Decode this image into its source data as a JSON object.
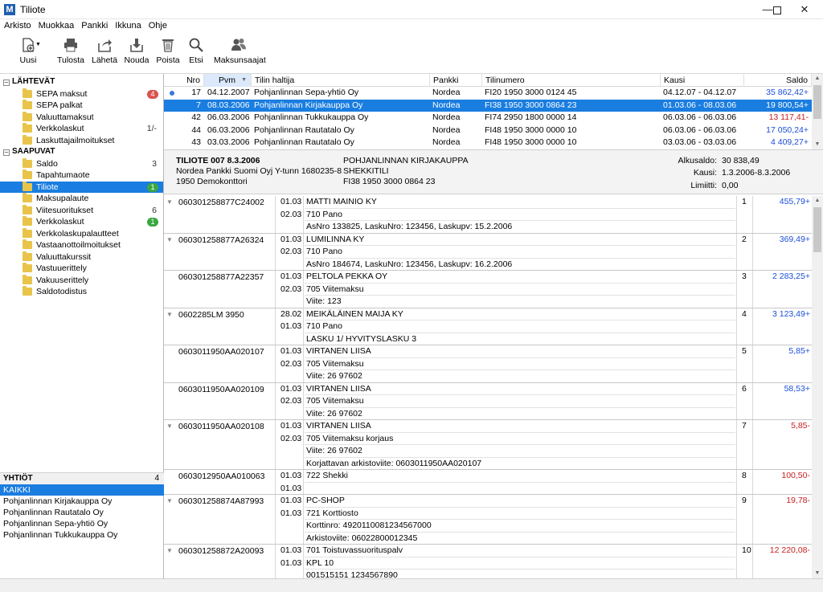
{
  "window": {
    "title": "Tiliote",
    "app_icon_letter": "M"
  },
  "menu": [
    "Arkisto",
    "Muokkaa",
    "Pankki",
    "Ikkuna",
    "Ohje"
  ],
  "toolbar": {
    "new": "Uusi",
    "print": "Tulosta",
    "send": "Lähetä",
    "fetch": "Nouda",
    "delete": "Poista",
    "search": "Etsi",
    "payees": "Maksunsaajat"
  },
  "sidebar": {
    "outgoing_header": "LÄHTEVÄT",
    "outgoing": [
      {
        "label": "SEPA maksut",
        "badge": "4",
        "badge_color": "#d9534f"
      },
      {
        "label": "SEPA palkat"
      },
      {
        "label": "Valuuttamaksut"
      },
      {
        "label": "Verkkolaskut",
        "count": "1/-"
      },
      {
        "label": "Laskuttajailmoitukset"
      }
    ],
    "incoming_header": "SAAPUVAT",
    "incoming": [
      {
        "label": "Saldo",
        "count": "3"
      },
      {
        "label": "Tapahtumaote"
      },
      {
        "label": "Tiliote",
        "badge": "1",
        "badge_color": "#3aa842",
        "selected": true
      },
      {
        "label": "Maksupalaute"
      },
      {
        "label": "Viitesuoritukset",
        "count": "6"
      },
      {
        "label": "Verkkolaskut",
        "badge": "1",
        "badge_color": "#3aa842"
      },
      {
        "label": "Verkkolaskupalautteet"
      },
      {
        "label": "Vastaanottoilmoitukset"
      },
      {
        "label": "Valuuttakurssit"
      },
      {
        "label": "Vastuuerittely"
      },
      {
        "label": "Vakuuserittely"
      },
      {
        "label": "Saldotodistus"
      }
    ]
  },
  "companies": {
    "header": "YHTIÖT",
    "count": "4",
    "items": [
      "KAIKKI",
      "Pohjanlinnan Kirjakauppa Oy",
      "Pohjanlinnan Rautatalo Oy",
      "Pohjanlinnan Sepa-yhtiö Oy",
      "Pohjanlinnan Tukkukauppa Oy"
    ]
  },
  "statements": {
    "columns": {
      "nro": "Nro",
      "pvm": "Pvm",
      "holder": "Tilin haltija",
      "bank": "Pankki",
      "account": "Tilinumero",
      "period": "Kausi",
      "balance": "Saldo"
    },
    "rows": [
      {
        "nro": "17",
        "pvm": "04.12.2007",
        "holder": "Pohjanlinnan Sepa-yhtiö Oy",
        "bank": "Nordea",
        "account": "FI20 1950 3000 0124 45",
        "period": "04.12.07 - 04.12.07",
        "balance": "35 862,42+",
        "sign": "pos",
        "dot": true
      },
      {
        "nro": "7",
        "pvm": "08.03.2006",
        "holder": "Pohjanlinnan Kirjakauppa Oy",
        "bank": "Nordea",
        "account": "FI38 1950 3000 0864 23",
        "period": "01.03.06 - 08.03.06",
        "balance": "19 800,54+",
        "sign": "pos",
        "selected": true
      },
      {
        "nro": "42",
        "pvm": "06.03.2006",
        "holder": "Pohjanlinnan Tukkukauppa Oy",
        "bank": "Nordea",
        "account": "FI74 2950 1800 0000 14",
        "period": "06.03.06 - 06.03.06",
        "balance": "13 117,41-",
        "sign": "neg"
      },
      {
        "nro": "44",
        "pvm": "06.03.2006",
        "holder": "Pohjanlinnan Rautatalo Oy",
        "bank": "Nordea",
        "account": "FI48 1950 3000 0000 10",
        "period": "06.03.06 - 06.03.06",
        "balance": "17 050,24+",
        "sign": "pos"
      },
      {
        "nro": "43",
        "pvm": "03.03.2006",
        "holder": "Pohjanlinnan Rautatalo Oy",
        "bank": "Nordea",
        "account": "FI48 1950 3000 0000 10",
        "period": "03.03.06 - 03.03.06",
        "balance": "4 409,27+",
        "sign": "pos"
      }
    ]
  },
  "detail": {
    "title": "TILIOTE 007  8.3.2006",
    "bank_line": "Nordea Pankki Suomi Oyj Y-tunn 1680235-8",
    "branch": "1950 Demokonttori",
    "company": "POHJANLINNAN KIRJAKAUPPA",
    "account_type": "SHEKKITILI",
    "account": "FI38 1950 3000 0864 23",
    "opening_label": "Alkusaldo:",
    "opening_value": "30 838,49",
    "period_label": "Kausi:",
    "period_value": "1.3.2006-8.3.2006",
    "limit_label": "Limiitti:",
    "limit_value": "0,00"
  },
  "transactions": [
    {
      "ref": "060301258877C24002",
      "dates": [
        "01.03",
        "02.03"
      ],
      "lines": [
        "MATTI MAINIO KY",
        "710 Pano",
        "AsNro 133825, LaskuNro: 123456, Laskupv: 15.2.2006"
      ],
      "num": "1",
      "amount": "455,79+",
      "sign": "pos",
      "arrow": true
    },
    {
      "ref": "060301258877A26324",
      "dates": [
        "01.03",
        "02.03"
      ],
      "lines": [
        "LUMILINNA KY",
        "710 Pano",
        "AsNro 184674, LaskuNro: 123456, Laskupv: 16.2.2006"
      ],
      "num": "2",
      "amount": "369,49+",
      "sign": "pos",
      "arrow": true
    },
    {
      "ref": "060301258877A22357",
      "dates": [
        "01.03",
        "02.03"
      ],
      "lines": [
        "PELTOLA PEKKA OY",
        "705 Viitemaksu",
        "Viite: 123"
      ],
      "num": "3",
      "amount": "2 283,25+",
      "sign": "pos"
    },
    {
      "ref": "0602285LM     3950",
      "dates": [
        "28.02",
        "01.03"
      ],
      "lines": [
        "MEIKÄLÄINEN MAIJA KY",
        "710 Pano",
        "LASKU 1/ HYVITYSLASKU 3"
      ],
      "num": "4",
      "amount": "3 123,49+",
      "sign": "pos",
      "arrow": true
    },
    {
      "ref": "0603011950AA020107",
      "dates": [
        "01.03",
        "02.03"
      ],
      "lines": [
        "VIRTANEN LIISA",
        "705 Viitemaksu",
        "Viite: 26 97602"
      ],
      "num": "5",
      "amount": "5,85+",
      "sign": "pos"
    },
    {
      "ref": "0603011950AA020109",
      "dates": [
        "01.03",
        "02.03"
      ],
      "lines": [
        "VIRTANEN LIISA",
        "705 Viitemaksu",
        "Viite: 26 97602"
      ],
      "num": "6",
      "amount": "58,53+",
      "sign": "pos"
    },
    {
      "ref": "0603011950AA020108",
      "dates": [
        "01.03",
        "02.03"
      ],
      "lines": [
        "VIRTANEN LIISA",
        "705 Viitemaksu korjaus",
        "Viite: 26 97602",
        "Korjattavan arkistoviite: 0603011950AA020107"
      ],
      "num": "7",
      "amount": "5,85-",
      "sign": "neg",
      "arrow": true
    },
    {
      "ref": "0603012950AA010063",
      "dates": [
        "01.03",
        "01.03"
      ],
      "lines": [
        "722 Shekki",
        ""
      ],
      "num": "8",
      "amount": "100,50-",
      "sign": "neg"
    },
    {
      "ref": "060301258874A87993",
      "dates": [
        "01.03",
        "01.03"
      ],
      "lines": [
        "PC-SHOP",
        "721 Korttiosto",
        "Korttinro: 4920110081234567000",
        "Arkistoviite: 06022800012345"
      ],
      "num": "9",
      "amount": "19,78-",
      "sign": "neg",
      "arrow": true
    },
    {
      "ref": "060301258872A20093",
      "dates": [
        "01.03",
        "01.03"
      ],
      "lines": [
        "701 Toistuvassuorituspalv",
        "KPL 10",
        "001515151 1234567890"
      ],
      "num": "10",
      "amount": "12 220,08-",
      "sign": "neg",
      "arrow": true
    }
  ]
}
